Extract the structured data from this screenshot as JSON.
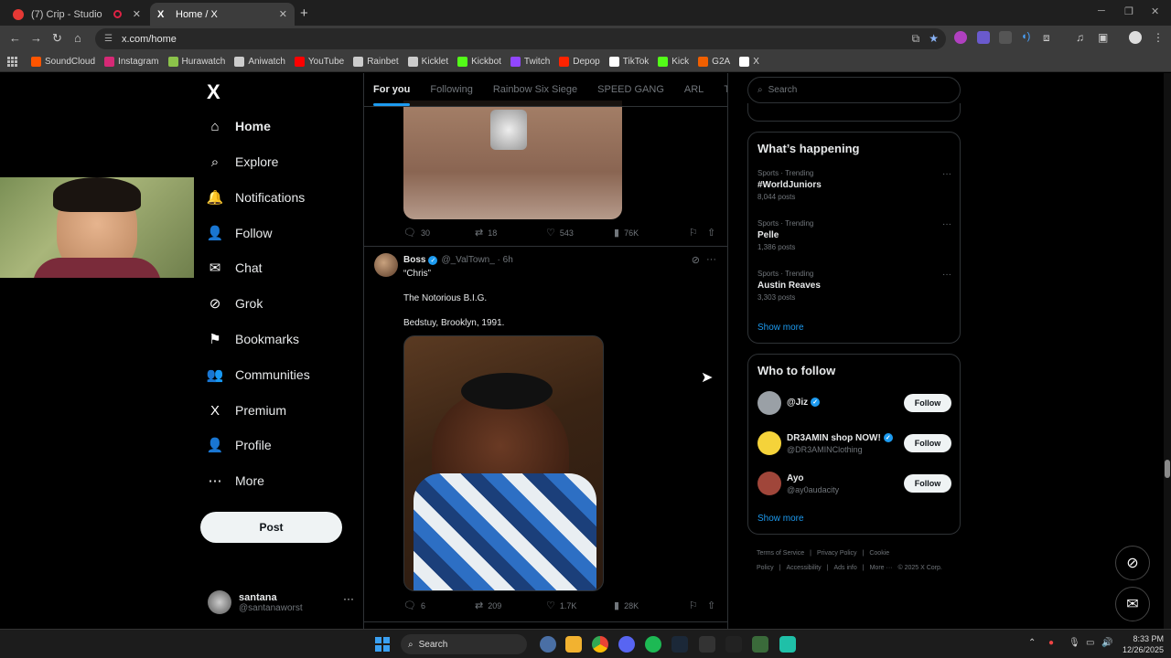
{
  "browser": {
    "tabs": [
      {
        "title": "(7) Crip - Studio",
        "favicon_color": "#e53935"
      },
      {
        "title": "Home / X",
        "favicon_color": "#ffffff"
      }
    ],
    "url": "x.com/home",
    "bookmarks": [
      {
        "label": "SoundCloud",
        "color": "#ff5500"
      },
      {
        "label": "Instagram",
        "color": "#d62976"
      },
      {
        "label": "Hurawatch",
        "color": "#8bc34a"
      },
      {
        "label": "Aniwatch",
        "color": "#cccccc"
      },
      {
        "label": "YouTube",
        "color": "#ff0000"
      },
      {
        "label": "Rainbet",
        "color": "#cccccc"
      },
      {
        "label": "Kicklet",
        "color": "#cccccc"
      },
      {
        "label": "Kickbot",
        "color": "#53fc18"
      },
      {
        "label": "Twitch",
        "color": "#9146ff"
      },
      {
        "label": "Depop",
        "color": "#ff2300"
      },
      {
        "label": "TikTok",
        "color": "#ffffff"
      },
      {
        "label": "Kick",
        "color": "#53fc18"
      },
      {
        "label": "G2A",
        "color": "#f05f00"
      },
      {
        "label": "X",
        "color": "#ffffff"
      }
    ]
  },
  "nav": {
    "logo": "X",
    "items": [
      {
        "label": "Home",
        "icon": "home-icon",
        "glyph": "⌂"
      },
      {
        "label": "Explore",
        "icon": "search-icon",
        "glyph": "⌕"
      },
      {
        "label": "Notifications",
        "icon": "bell-icon",
        "glyph": "🔔"
      },
      {
        "label": "Follow",
        "icon": "person-add-icon",
        "glyph": "👤"
      },
      {
        "label": "Chat",
        "icon": "mail-icon",
        "glyph": "✉"
      },
      {
        "label": "Grok",
        "icon": "grok-icon",
        "glyph": "⊘"
      },
      {
        "label": "Bookmarks",
        "icon": "bookmark-icon",
        "glyph": "⚑"
      },
      {
        "label": "Communities",
        "icon": "communities-icon",
        "glyph": "👥"
      },
      {
        "label": "Premium",
        "icon": "x-premium-icon",
        "glyph": "X"
      },
      {
        "label": "Profile",
        "icon": "profile-icon",
        "glyph": "👤"
      },
      {
        "label": "More",
        "icon": "more-icon",
        "glyph": "⋯"
      }
    ],
    "post_label": "Post",
    "account": {
      "name": "santana",
      "handle": "@santanaworst"
    }
  },
  "feed": {
    "tabs": [
      "For you",
      "Following",
      "Rainbow Six Siege",
      "SPEED GANG",
      "ARL",
      "The Stabl"
    ],
    "tweet1_stats": {
      "replies": "30",
      "reposts": "18",
      "likes": "543",
      "views": "76K"
    },
    "tweet2": {
      "name": "Boss",
      "handle": "@_ValTown_ · 6h",
      "lines": [
        "“Chris”",
        "The Notorious B.I.G.",
        "Bedstuy, Brooklyn, 1991."
      ],
      "stats": {
        "replies": "6",
        "reposts": "209",
        "likes": "1.7K",
        "views": "28K"
      }
    }
  },
  "sidebar": {
    "search_placeholder": "Search",
    "happening": {
      "title": "What’s happening",
      "trends": [
        {
          "category": "Sports · Trending",
          "title": "#WorldJuniors",
          "count": "8,044 posts"
        },
        {
          "category": "Sports · Trending",
          "title": "Pelle",
          "count": "1,386 posts"
        },
        {
          "category": "Sports · Trending",
          "title": "Austin Reaves",
          "count": "3,303 posts"
        }
      ],
      "show_more": "Show more"
    },
    "who_to_follow": {
      "title": "Who to follow",
      "accounts": [
        {
          "name": "@Jiz",
          "handle": "",
          "verified": true,
          "avatar_color": "#9aa0a6"
        },
        {
          "name": "DR3AMIN shop NOW!",
          "handle": "@DR3AMINClothing",
          "verified": true,
          "avatar_color": "#f5d33a"
        },
        {
          "name": "Ayo",
          "handle": "@ay0audacity",
          "verified": false,
          "avatar_color": "#a0463a"
        }
      ],
      "follow_label": "Follow",
      "show_more": "Show more"
    },
    "footer": [
      "Terms of Service",
      "|",
      "Privacy Policy",
      "|",
      "Cookie Policy",
      "|",
      "Accessibility",
      "|",
      "Ads info",
      "|",
      "More ···",
      "© 2025 X Corp."
    ]
  },
  "taskbar": {
    "search_label": "Search",
    "time": "8:33 PM",
    "date": "12/26/2025"
  }
}
